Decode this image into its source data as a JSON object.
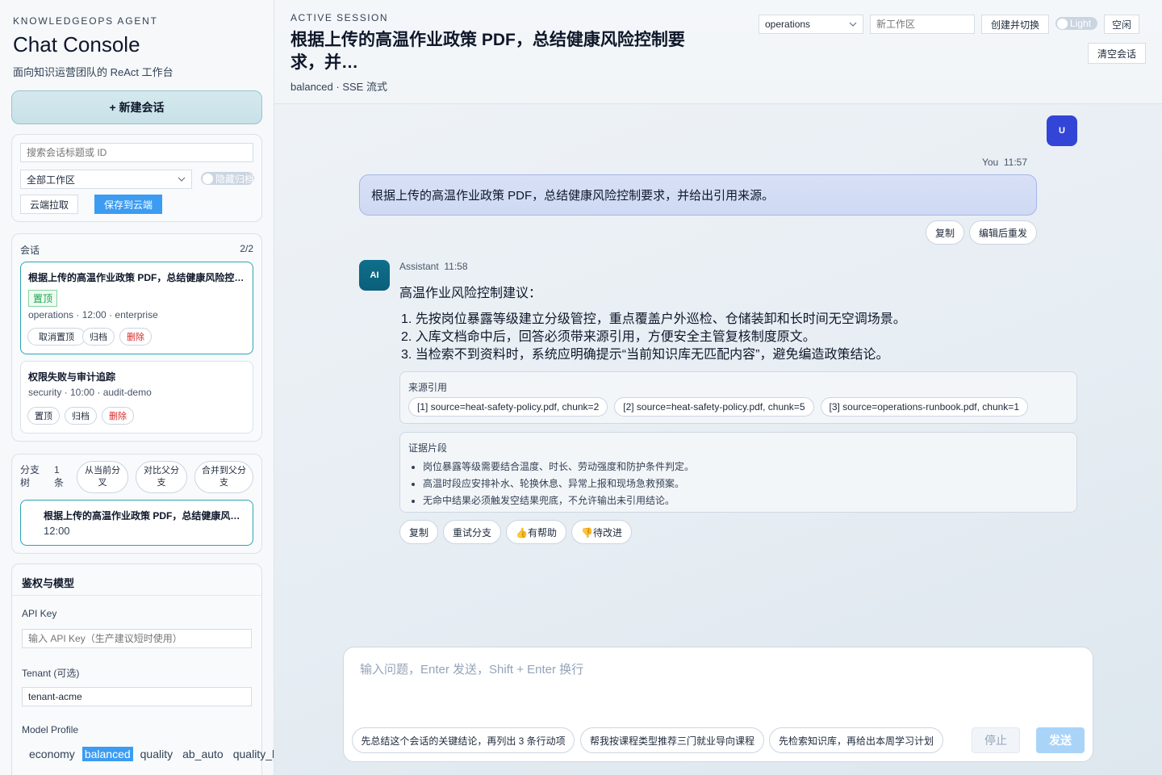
{
  "sidebar": {
    "eyebrow": "KNOWLEDGEOPS AGENT",
    "title": "Chat Console",
    "subtitle": "面向知识运营团队的 ReAct 工作台",
    "new_chat_label": "+ 新建会话",
    "search_placeholder": "搜索会话标题或 ID",
    "workspace_filter": "全部工作区",
    "hide_archived_label": "隐藏归档",
    "cloud_pull_label": "云端拉取",
    "save_cloud_label": "保存到云端",
    "sessions_label": "会话",
    "sessions_count": "2/2",
    "sessions": [
      {
        "title": "根据上传的高温作业政策 PDF，总结健康风险控制要求，并给出引用来源。",
        "badge": "置顶",
        "meta": "operations · 12:00 · enterprise",
        "actions": [
          "取消置顶",
          "归档",
          "删除"
        ]
      },
      {
        "title": "权限失败与审计追踪",
        "meta": "security · 10:00 · audit-demo",
        "actions": [
          "置顶",
          "归档",
          "删除"
        ]
      }
    ],
    "branch": {
      "label": "分支树",
      "count": "1 条",
      "fork_label": "从当前分叉",
      "compare_label": "对比父分支",
      "merge_label": "合并到父分支",
      "item_title": "根据上传的高温作业政策 PDF，总结健康风险控制要求，并给出引用来源。",
      "item_time": "12:00"
    },
    "auth": {
      "title": "鉴权与模型",
      "api_key_label": "API Key",
      "api_key_placeholder": "输入 API Key（生产建议短时使用）",
      "tenant_label": "Tenant (可选)",
      "tenant_value": "tenant-acme",
      "profile_label": "Model Profile",
      "profiles": [
        "economy",
        "balanced",
        "quality",
        "ab_auto",
        "quality_high"
      ],
      "active_profile": "balanced"
    }
  },
  "header": {
    "eyebrow": "ACTIVE SESSION",
    "title": "根据上传的高温作业政策 PDF，总结健康风险控制要求，并…",
    "subtitle": "balanced · SSE 流式",
    "workspace_select": "operations",
    "new_workspace_placeholder": "新工作区",
    "create_switch_label": "创建并切换",
    "theme_label": "Light",
    "idle_label": "空闲",
    "clear_label": "清空会话"
  },
  "chat": {
    "user": {
      "avatar": "U",
      "name": "You",
      "time": "11:57",
      "text": "根据上传的高温作业政策 PDF，总结健康风险控制要求，并给出引用来源。",
      "copy_label": "复制",
      "edit_label": "编辑后重发"
    },
    "assistant": {
      "avatar": "AI",
      "name": "Assistant",
      "time": "11:58",
      "intro": "高温作业风险控制建议：",
      "points": [
        "1. 先按岗位暴露等级建立分级管控，重点覆盖户外巡检、仓储装卸和长时间无空调场景。",
        "2. 入库文档命中后，回答必须带来源引用，方便安全主管复核制度原文。",
        "3. 当检索不到资料时，系统应明确提示“当前知识库无匹配内容”，避免编造政策结论。"
      ],
      "sources_title": "来源引用",
      "sources": [
        "[1] source=heat-safety-policy.pdf, chunk=2",
        "[2] source=heat-safety-policy.pdf, chunk=5",
        "[3] source=operations-runbook.pdf, chunk=1"
      ],
      "evidence_title": "证据片段",
      "evidence": [
        "岗位暴露等级需要结合温度、时长、劳动强度和防护条件判定。",
        "高温时段应安排补水、轮换休息、异常上报和现场急救预案。",
        "无命中结果必须触发空结果兜底，不允许输出未引用结论。"
      ],
      "actions": [
        "复制",
        "重试分支",
        "👍有帮助",
        "👎待改进"
      ]
    }
  },
  "composer": {
    "placeholder": "输入问题，Enter 发送，Shift + Enter 换行",
    "suggestions": [
      "先总结这个会话的关键结论，再列出 3 条行动项",
      "帮我按课程类型推荐三门就业导向课程",
      "先检索知识库，再给出本周学习计划"
    ],
    "stop_label": "停止",
    "send_label": "发送"
  }
}
